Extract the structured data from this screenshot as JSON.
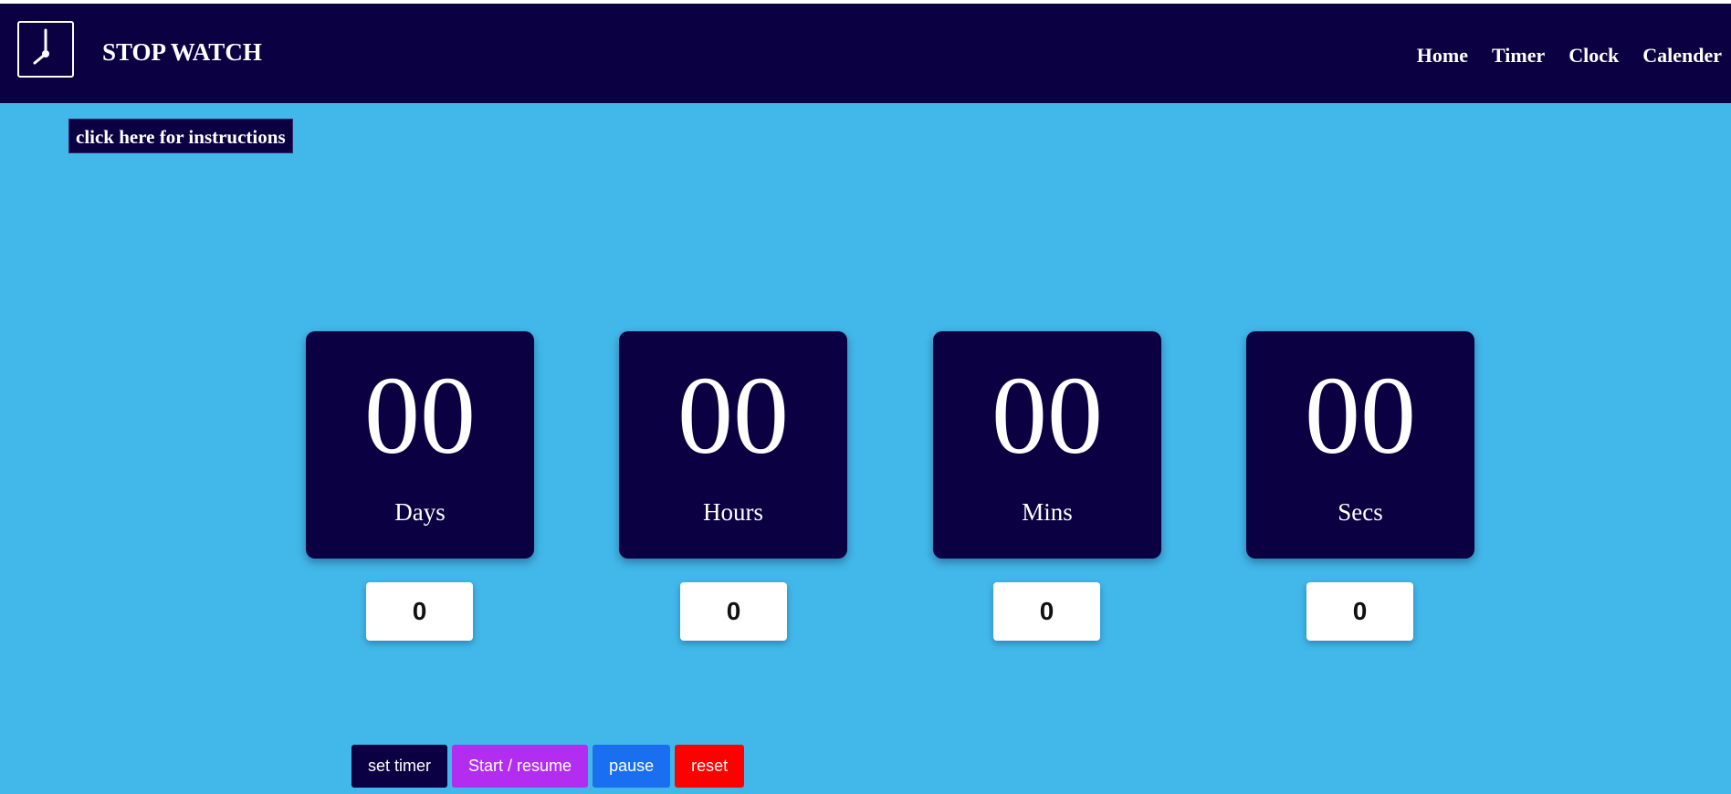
{
  "header": {
    "brand": "STOP WATCH",
    "logo_icon": "clock-icon",
    "nav": [
      "Home",
      "Timer",
      "Clock",
      "Calender"
    ]
  },
  "instructions_link": "click here for instructions",
  "counters": [
    {
      "value": "00",
      "label": "Days",
      "input": "0"
    },
    {
      "value": "00",
      "label": "Hours",
      "input": "0"
    },
    {
      "value": "00",
      "label": "Mins",
      "input": "0"
    },
    {
      "value": "00",
      "label": "Secs",
      "input": "0"
    }
  ],
  "buttons": {
    "set_timer": "set timer",
    "start_resume": "Start / resume",
    "pause": "pause",
    "reset": "reset"
  },
  "colors": {
    "background": "#42b8ea",
    "navy": "#0a0042",
    "start": "#b22df0",
    "pause": "#1a6ff0",
    "reset": "#ff0000"
  }
}
